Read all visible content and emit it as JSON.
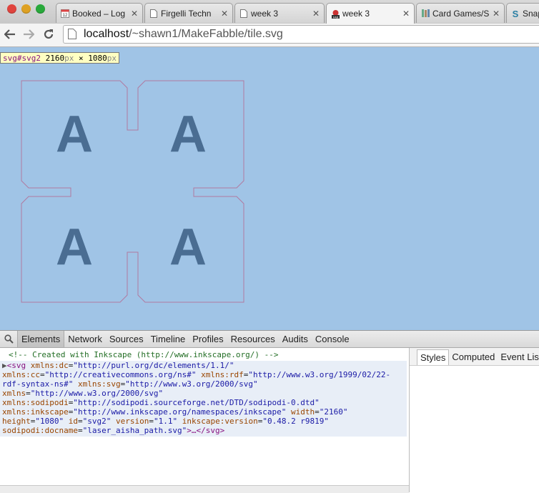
{
  "tabs": [
    {
      "label": "Booked – Log",
      "icon": "calendar-icon",
      "active": false
    },
    {
      "label": "Firgelli Techn",
      "icon": "page-icon",
      "active": false
    },
    {
      "label": "week 3",
      "icon": "page-icon",
      "active": false
    },
    {
      "label": "week 3",
      "icon": "fab-icon",
      "active": true
    },
    {
      "label": "Card Games/S",
      "icon": "books-icon",
      "active": false
    },
    {
      "label": "Snap",
      "icon": "snap-icon",
      "active": false
    }
  ],
  "toolbar": {
    "url_host": "localhost",
    "url_path": "/~shawn1/MakeFabble/tile.svg"
  },
  "inspect_tip": {
    "selector": "svg#svg2",
    "width": "2160",
    "times": "×",
    "height": "1080",
    "unit": "px"
  },
  "tile": {
    "letter": "A",
    "letter_color": "#4a6d92",
    "outline_color": "#b07aa0",
    "background": "#a0c4e6"
  },
  "devtools": {
    "tabs": [
      "Elements",
      "Network",
      "Sources",
      "Timeline",
      "Profiles",
      "Resources",
      "Audits",
      "Console"
    ],
    "side_tabs": [
      "Styles",
      "Computed",
      "Event Lis"
    ],
    "comment": "<!-- Created with Inkscape (http://www.inkscape.org/) -->",
    "svg_element": {
      "open": "<svg",
      "attrs": [
        {
          "name": "xmlns:dc",
          "value": "\"http://purl.org/dc/elements/1.1/\""
        },
        {
          "name": "xmlns:cc",
          "value": "\"http://creativecommons.org/ns#\""
        },
        {
          "name": "xmlns:rdf",
          "value": "\"http://www.w3.org/1999/02/22-rdf-syntax-ns#\""
        },
        {
          "name": "xmlns:svg",
          "value": "\"http://www.w3.org/2000/svg\""
        },
        {
          "name": "xmlns",
          "value": "\"http://www.w3.org/2000/svg\""
        },
        {
          "name": "xmlns:sodipodi",
          "value": "\"http://sodipodi.sourceforge.net/DTD/sodipodi-0.dtd\""
        },
        {
          "name": "xmlns:inkscape",
          "value": "\"http://www.inkscape.org/namespaces/inkscape\""
        },
        {
          "name": "width",
          "value": "\"2160\""
        },
        {
          "name": "height",
          "value": "\"1080\""
        },
        {
          "name": "id",
          "value": "\"svg2\""
        },
        {
          "name": "version",
          "value": "\"1.1\""
        },
        {
          "name": "inkscape:version",
          "value": "\"0.48.2 r9819\""
        },
        {
          "name": "sodipodi:docname",
          "value": "\"laser_aisha_path.svg\""
        }
      ],
      "close": ">…</svg>"
    }
  }
}
